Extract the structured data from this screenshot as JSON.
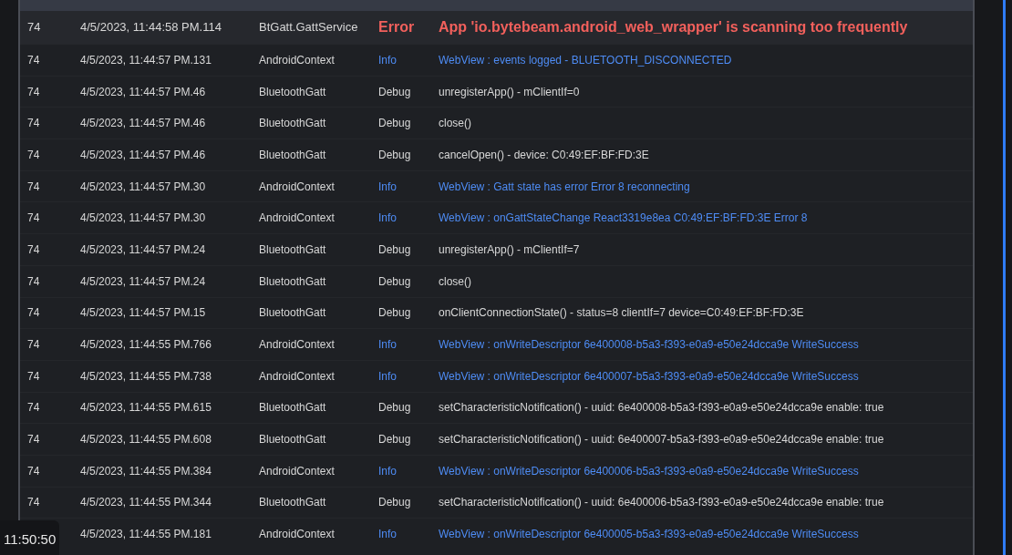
{
  "log_rows": [
    {
      "kind": "error",
      "id": "74",
      "timestamp": "4/5/2023, 11:44:58 PM.114",
      "tag": "BtGatt.GattService",
      "level": "Error",
      "message": "App 'io.bytebeam.android_web_wrapper' is scanning too frequently"
    },
    {
      "kind": "info",
      "id": "74",
      "timestamp": "4/5/2023, 11:44:57 PM.131",
      "tag": "AndroidContext",
      "level": "Info",
      "message": "WebView : events logged - BLUETOOTH_DISCONNECTED"
    },
    {
      "kind": "debug",
      "id": "74",
      "timestamp": "4/5/2023, 11:44:57 PM.46",
      "tag": "BluetoothGatt",
      "level": "Debug",
      "message": "unregisterApp() - mClientIf=0"
    },
    {
      "kind": "debug",
      "id": "74",
      "timestamp": "4/5/2023, 11:44:57 PM.46",
      "tag": "BluetoothGatt",
      "level": "Debug",
      "message": "close()"
    },
    {
      "kind": "debug",
      "id": "74",
      "timestamp": "4/5/2023, 11:44:57 PM.46",
      "tag": "BluetoothGatt",
      "level": "Debug",
      "message": "cancelOpen() - device: C0:49:EF:BF:FD:3E"
    },
    {
      "kind": "info",
      "id": "74",
      "timestamp": "4/5/2023, 11:44:57 PM.30",
      "tag": "AndroidContext",
      "level": "Info",
      "message": "WebView : Gatt state has error Error 8 reconnecting"
    },
    {
      "kind": "info",
      "id": "74",
      "timestamp": "4/5/2023, 11:44:57 PM.30",
      "tag": "AndroidContext",
      "level": "Info",
      "message": "WebView : onGattStateChange React3319e8ea C0:49:EF:BF:FD:3E Error 8"
    },
    {
      "kind": "debug",
      "id": "74",
      "timestamp": "4/5/2023, 11:44:57 PM.24",
      "tag": "BluetoothGatt",
      "level": "Debug",
      "message": "unregisterApp() - mClientIf=7"
    },
    {
      "kind": "debug",
      "id": "74",
      "timestamp": "4/5/2023, 11:44:57 PM.24",
      "tag": "BluetoothGatt",
      "level": "Debug",
      "message": "close()"
    },
    {
      "kind": "debug",
      "id": "74",
      "timestamp": "4/5/2023, 11:44:57 PM.15",
      "tag": "BluetoothGatt",
      "level": "Debug",
      "message": "onClientConnectionState() - status=8 clientIf=7 device=C0:49:EF:BF:FD:3E"
    },
    {
      "kind": "info",
      "id": "74",
      "timestamp": "4/5/2023, 11:44:55 PM.766",
      "tag": "AndroidContext",
      "level": "Info",
      "message": "WebView : onWriteDescriptor 6e400008-b5a3-f393-e0a9-e50e24dcca9e WriteSuccess"
    },
    {
      "kind": "info",
      "id": "74",
      "timestamp": "4/5/2023, 11:44:55 PM.738",
      "tag": "AndroidContext",
      "level": "Info",
      "message": "WebView : onWriteDescriptor 6e400007-b5a3-f393-e0a9-e50e24dcca9e WriteSuccess"
    },
    {
      "kind": "debug",
      "id": "74",
      "timestamp": "4/5/2023, 11:44:55 PM.615",
      "tag": "BluetoothGatt",
      "level": "Debug",
      "message": "setCharacteristicNotification() - uuid: 6e400008-b5a3-f393-e0a9-e50e24dcca9e enable: true"
    },
    {
      "kind": "debug",
      "id": "74",
      "timestamp": "4/5/2023, 11:44:55 PM.608",
      "tag": "BluetoothGatt",
      "level": "Debug",
      "message": "setCharacteristicNotification() - uuid: 6e400007-b5a3-f393-e0a9-e50e24dcca9e enable: true"
    },
    {
      "kind": "info",
      "id": "74",
      "timestamp": "4/5/2023, 11:44:55 PM.384",
      "tag": "AndroidContext",
      "level": "Info",
      "message": "WebView : onWriteDescriptor 6e400006-b5a3-f393-e0a9-e50e24dcca9e WriteSuccess"
    },
    {
      "kind": "debug",
      "id": "74",
      "timestamp": "4/5/2023, 11:44:55 PM.344",
      "tag": "BluetoothGatt",
      "level": "Debug",
      "message": "setCharacteristicNotification() - uuid: 6e400006-b5a3-f393-e0a9-e50e24dcca9e enable: true"
    },
    {
      "kind": "info",
      "timestamp": "4/5/2023, 11:44:55 PM.181",
      "tag": "AndroidContext",
      "level": "Info",
      "message": "WebView : onWriteDescriptor 6e400005-b5a3-f393-e0a9-e50e24dcca9e WriteSuccess"
    }
  ],
  "clock": "11:50:50"
}
